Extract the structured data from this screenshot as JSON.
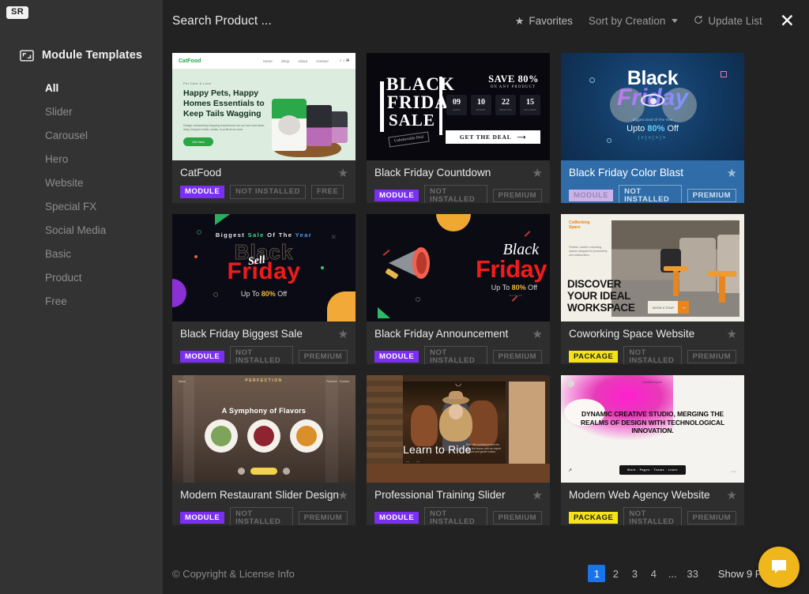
{
  "sidebar": {
    "logo": "SR",
    "header": {
      "label": "Module Templates",
      "icon": "expand-rect-icon"
    },
    "items": [
      {
        "label": "All",
        "active": true
      },
      {
        "label": "Slider",
        "active": false
      },
      {
        "label": "Carousel",
        "active": false
      },
      {
        "label": "Hero",
        "active": false
      },
      {
        "label": "Website",
        "active": false
      },
      {
        "label": "Special FX",
        "active": false
      },
      {
        "label": "Social Media",
        "active": false
      },
      {
        "label": "Basic",
        "active": false
      },
      {
        "label": "Product",
        "active": false
      },
      {
        "label": "Free",
        "active": false
      }
    ]
  },
  "topbar": {
    "search_value": "",
    "search_placeholder": "Search Product ...",
    "favorites_label": "Favorites",
    "favorites_icon": "star-icon",
    "sort_label": "Sort by Creation",
    "sort_caret_icon": "chevron-down-icon",
    "update_label": "Update List",
    "update_icon": "refresh-icon",
    "close_icon": "close-icon"
  },
  "cards": [
    {
      "title": "CatFood",
      "type_badge": "MODULE",
      "type": "module",
      "install_badge": "NOT INSTALLED",
      "license_badge": "FREE",
      "favorite_icon": "star-icon",
      "hovered": false,
      "thumb": {
        "kind": "catfood",
        "logo": "CatFood",
        "nav": [
          "Home",
          "Shop",
          "About",
          "Contact"
        ],
        "kicker": "Pet Care & Love",
        "heading": "Happy Pets, Happy Homes Essentials to Keep Tails Wagging",
        "paragraph": "Design outstanding shopping experiences for our love and clean, daily, frequent within, meals, & profit at an once.",
        "button": "Get Now"
      }
    },
    {
      "title": "Black Friday Countdown",
      "type_badge": "MODULE",
      "type": "module",
      "install_badge": "NOT INSTALLED",
      "license_badge": "PREMIUM",
      "favorite_icon": "star-icon",
      "hovered": false,
      "thumb": {
        "kind": "bf-countdown",
        "line1": "BLACK",
        "line2": "FRIDAY",
        "line3": "SALE",
        "stamp": "Unbelievable Deal",
        "save": "SAVE 80%",
        "save_sub": "ON ANY PRODUCT",
        "countdown": [
          {
            "value": "09",
            "label": "DAYS"
          },
          {
            "value": "10",
            "label": "HOURS"
          },
          {
            "value": "22",
            "label": "MINUTES"
          },
          {
            "value": "15",
            "label": "SECONDS"
          }
        ],
        "cta": "GET THE DEAL"
      }
    },
    {
      "title": "Black Friday Color Blast",
      "type_badge": "MODULE",
      "type": "module",
      "install_badge": "NOT INSTALLED",
      "license_badge": "PREMIUM",
      "favorite_icon": "star-icon",
      "hovered": true,
      "thumb": {
        "kind": "bf-colorblast",
        "line1": "Black",
        "line2": "Friday",
        "small": "Biggest Deal Of The Year",
        "offer_pre": "Upto ",
        "offer_bold": "80%",
        "offer_post": " Off",
        "dots": "|>|>|>|>"
      }
    },
    {
      "title": "Black Friday Biggest Sale",
      "type_badge": "MODULE",
      "type": "module",
      "install_badge": "NOT INSTALLED",
      "license_badge": "PREMIUM",
      "favorite_icon": "star-icon",
      "hovered": false,
      "thumb": {
        "kind": "bf-biggest",
        "kicker_1": "Biggest ",
        "kicker_2": "Sale",
        "kicker_3": " Of The ",
        "kicker_4": "Year",
        "black": "Black",
        "friday": "Friday",
        "script": "Sell",
        "offer_pre": "Up To ",
        "offer_bold": "80%",
        "offer_post": " Off"
      }
    },
    {
      "title": "Black Friday Announcement",
      "type_badge": "MODULE",
      "type": "module",
      "install_badge": "NOT INSTALLED",
      "license_badge": "PREMIUM",
      "favorite_icon": "star-icon",
      "hovered": false,
      "thumb": {
        "kind": "bf-announce",
        "black": "Black",
        "friday": "Friday",
        "offer_pre": "Up To ",
        "offer_bold": "80%",
        "offer_post": " Off"
      }
    },
    {
      "title": "Coworking Space Website",
      "type_badge": "PACKAGE",
      "type": "package",
      "install_badge": "NOT INSTALLED",
      "license_badge": "PREMIUM",
      "favorite_icon": "star-icon",
      "hovered": false,
      "thumb": {
        "kind": "coworking",
        "logo": "CoWorking",
        "logo_accent": "Space",
        "paragraph": "Flexible, modern coworking spaces designed for productivity and collaboration.",
        "heading": "DISCOVER YOUR IDEAL WORKSPACE",
        "cta": "BOOK A TOUR"
      }
    },
    {
      "title": "Modern Restaurant Slider Design",
      "type_badge": "MODULE",
      "type": "module",
      "install_badge": "NOT INSTALLED",
      "license_badge": "PREMIUM",
      "favorite_icon": "star-icon",
      "hovered": false,
      "thumb": {
        "kind": "restaurant",
        "brand": "PERFECTION",
        "heading": "A Symphony of Flavors"
      }
    },
    {
      "title": "Professional Training Slider",
      "type_badge": "MODULE",
      "type": "module",
      "install_badge": "NOT INSTALLED",
      "license_badge": "PREMIUM",
      "favorite_icon": "star-icon",
      "hovered": false,
      "thumb": {
        "kind": "riding",
        "heading": "Learn to Ride",
        "side_text": "Ride with confidence from the very first lesson with our expert trainers and gentle horses."
      }
    },
    {
      "title": "Modern Web Agency Website",
      "type_badge": "PACKAGE",
      "type": "package",
      "install_badge": "NOT INSTALLED",
      "license_badge": "PREMIUM",
      "favorite_icon": "star-icon",
      "hovered": false,
      "thumb": {
        "kind": "webagency",
        "logo": "newartique",
        "heading": "DYNAMIC CREATIVE STUDIO, MERGING THE REALMS OF DESIGN WITH TECHNOLOGICAL INNOVATION.",
        "menu": "Work  ·  Pages  ·  Teams  ·  Learn"
      }
    }
  ],
  "footer": {
    "copyright": "© Copyright & License Info",
    "pagination": [
      "1",
      "2",
      "3",
      "4",
      "...",
      "33"
    ],
    "current_page": "1",
    "per_page_label": "Show 9 Per Page",
    "chat_icon": "chat-bubble-icon"
  },
  "colors": {
    "accent_blue": "#1a73e8",
    "module_purple": "#7b2ff2",
    "package_yellow": "#f5e318",
    "chat_yellow": "#f0b71c",
    "card_hover_blue": "#2f6ca8"
  }
}
